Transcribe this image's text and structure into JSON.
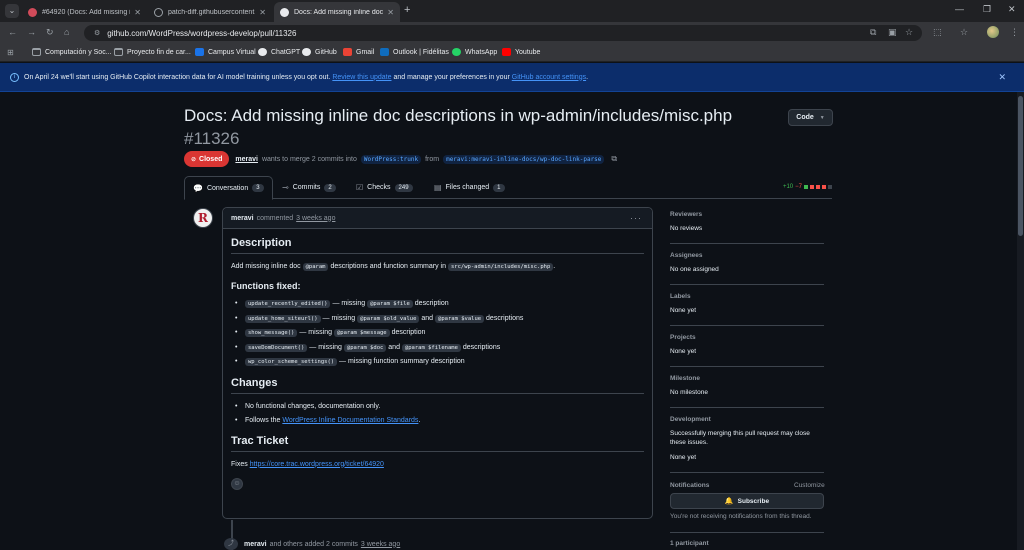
{
  "browser": {
    "tabs": [
      {
        "title": "#64920 (Docs: Add missing inli",
        "color": "#d14b5a"
      },
      {
        "title": "patch-diff.githubusercontent.co",
        "color": "#9aa0a6"
      },
      {
        "title": "Docs: Add missing inline doc de",
        "color": "#e8eaed"
      }
    ],
    "url": "github.com/WordPress/wordpress-develop/pull/11326",
    "bookmarks": [
      "Computación y Soc...",
      "Proyecto fin de car...",
      "Campus Virtual",
      "ChatGPT",
      "GitHub",
      "Gmail",
      "Outlook | Fidélitas",
      "WhatsApp",
      "Youtube"
    ]
  },
  "banner": {
    "text_before": "On April 24 we'll start using GitHub Copilot interaction data for AI model training unless you opt out.",
    "link1": "Review this update",
    "text_mid": "and manage your preferences in your",
    "link2": "GitHub account settings",
    "text_end": "."
  },
  "pr": {
    "title": "Docs: Add missing inline doc descriptions in wp-admin/includes/misc.php",
    "number": "#11326",
    "code_label": "Code",
    "status": "Closed",
    "author": "meravi",
    "meta_text": "wants to merge 2 commits into",
    "base_branch": "WordPress:trunk",
    "from_text": "from",
    "head_branch": "meravi:meravi-inline-docs/wp-doc-link-parse"
  },
  "tabs": [
    {
      "label": "Conversation",
      "count": "3"
    },
    {
      "label": "Commits",
      "count": "2"
    },
    {
      "label": "Checks",
      "count": "249"
    },
    {
      "label": "Files changed",
      "count": "1"
    }
  ],
  "diffstat": {
    "add": "+10",
    "del": "−7"
  },
  "comment": {
    "author": "meravi",
    "action": "commented",
    "time": "3 weeks ago",
    "description_h": "Description",
    "desc_a": "Add missing inline doc",
    "desc_code1": "@param",
    "desc_b": "descriptions and function summary in",
    "desc_code2": "src/wp-admin/includes/misc.php",
    "desc_c": ".",
    "functions_h": "Functions fixed:",
    "functions": [
      {
        "code": "update_recently_edited()",
        "t1": "— missing",
        "c2": "@param $file",
        "t2": "description",
        "c3": "",
        "t3": ""
      },
      {
        "code": "update_home_siteurl()",
        "t1": "— missing",
        "c2": "@param $old_value",
        "t2": "and",
        "c3": "@param $value",
        "t3": "descriptions"
      },
      {
        "code": "show_message()",
        "t1": "— missing",
        "c2": "@param $message",
        "t2": "description",
        "c3": "",
        "t3": ""
      },
      {
        "code": "saveDomDocument()",
        "t1": "— missing",
        "c2": "@param $doc",
        "t2": "and",
        "c3": "@param $filename",
        "t3": "descriptions"
      },
      {
        "code": "wp_color_scheme_settings()",
        "t1": "— missing function summary description",
        "c2": "",
        "t2": "",
        "c3": "",
        "t3": ""
      }
    ],
    "changes_h": "Changes",
    "change1": "No functional changes, documentation only.",
    "change2_a": "Follows the",
    "change2_link": "WordPress Inline Documentation Standards",
    "change2_b": ".",
    "trac_h": "Trac Ticket",
    "fixes": "Fixes",
    "trac_link": "https://core.trac.wordpress.org/ticket/64920"
  },
  "commits_event": {
    "author": "meravi",
    "text": "and others added 2 commits",
    "time": "3 weeks ago"
  },
  "sidebar": {
    "reviewers_h": "Reviewers",
    "reviewers_v": "No reviews",
    "assignees_h": "Assignees",
    "assignees_v": "No one assigned",
    "labels_h": "Labels",
    "labels_v": "None yet",
    "projects_h": "Projects",
    "projects_v": "None yet",
    "milestone_h": "Milestone",
    "milestone_v": "No milestone",
    "development_h": "Development",
    "development_t": "Successfully merging this pull request may close these issues.",
    "development_v": "None yet",
    "notifications_h": "Notifications",
    "customize": "Customize",
    "subscribe": "Subscribe",
    "notif_text": "You're not receiving notifications from this thread.",
    "participants": "1 participant"
  }
}
